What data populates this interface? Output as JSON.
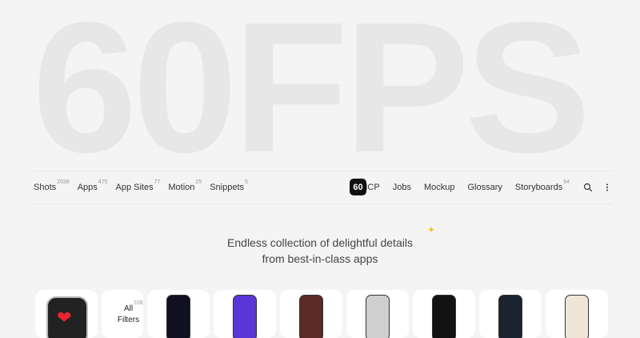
{
  "hero": {
    "text": "60FPS"
  },
  "nav": {
    "left": [
      {
        "label": "Shots",
        "count": "2038"
      },
      {
        "label": "Apps",
        "count": "475"
      },
      {
        "label": "App Sites",
        "count": "77"
      },
      {
        "label": "Motion",
        "count": "25"
      },
      {
        "label": "Snippets",
        "count": "5"
      }
    ],
    "logo": "60",
    "right": [
      {
        "label": "MCP",
        "count": ""
      },
      {
        "label": "Jobs",
        "count": ""
      },
      {
        "label": "Mockup",
        "count": ""
      },
      {
        "label": "Glossary",
        "count": ""
      },
      {
        "label": "Storyboards",
        "count": "64"
      }
    ]
  },
  "tagline": {
    "line1": "Endless collection of delightful details",
    "line2": "from best-in-class apps"
  },
  "filter": {
    "label": "All Filters",
    "count": "108"
  },
  "colors": {
    "accent": "#111111",
    "sparkle": "#f4c534"
  },
  "icons": [
    "search-icon",
    "more-vertical-icon",
    "sparkle-icon",
    "heart-icon"
  ]
}
